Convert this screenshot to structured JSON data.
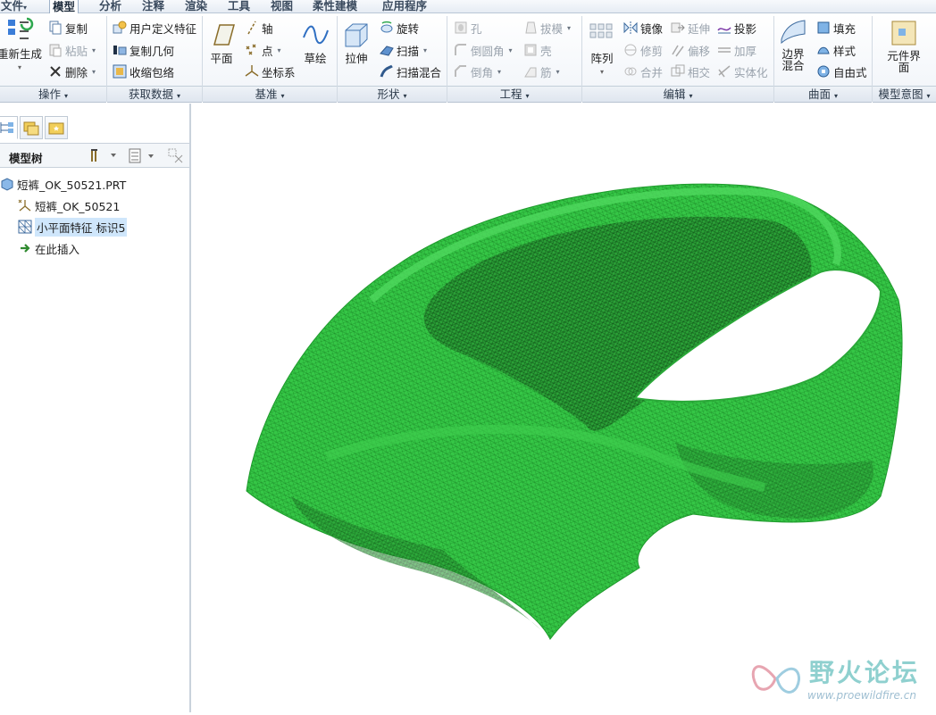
{
  "menu": {
    "tabs": [
      "文件",
      "模型",
      "分析",
      "注释",
      "渲染",
      "工具",
      "视图",
      "柔性建模",
      "应用程序"
    ],
    "active": "模型"
  },
  "ribbon": {
    "operations": {
      "regenerate": "重新生成",
      "copy": "复制",
      "paste": "粘贴",
      "delete": "删除"
    },
    "get_data": {
      "udf": "用户定义特征",
      "copy_geom": "复制几何",
      "shrinkwrap": "收缩包络"
    },
    "datum": {
      "plane": "平面",
      "axis": "轴",
      "point": "点",
      "csys": "坐标系",
      "sketch": "草绘"
    },
    "shapes": {
      "extrude": "拉伸",
      "revolve": "旋转",
      "sweep": "扫描",
      "swept_blend": "扫描混合"
    },
    "engineering": {
      "hole": "孔",
      "draft": "拔模",
      "round": "倒圆角",
      "shell": "壳",
      "chamfer": "倒角",
      "rib": "筋"
    },
    "editing": {
      "pattern": "阵列",
      "mirror": "镜像",
      "extend": "延伸",
      "project": "投影",
      "trim": "修剪",
      "offset": "偏移",
      "thicken": "加厚",
      "merge": "合并",
      "intersect": "相交",
      "solidify": "实体化"
    },
    "surfaces": {
      "boundary_blend": "边界混合",
      "fill": "填充",
      "style": "样式",
      "freestyle": "自由式"
    },
    "model_intent": {
      "component_interface": "元件界面"
    },
    "groups": {
      "operations": "操作",
      "get_data": "获取数据",
      "datum": "基准",
      "shapes": "形状",
      "engineering": "工程",
      "editing": "编辑",
      "surfaces": "曲面",
      "model_intent": "模型意图"
    }
  },
  "tree": {
    "title": "模型树",
    "items": [
      {
        "label": "短裤_OK_50521.PRT",
        "icon": "part-icon"
      },
      {
        "label": "短裤_OK_50521",
        "icon": "csys-icon"
      },
      {
        "label": "小平面特征 标识5",
        "icon": "facet-feature-icon"
      },
      {
        "label": "在此插入",
        "icon": "insert-arrow-icon"
      }
    ]
  },
  "viewport": {
    "mesh_color": "#2fc13f",
    "mesh_dark": "#177a22"
  },
  "watermark": {
    "title": "野火论坛",
    "url": "www.proewildfire.cn"
  }
}
